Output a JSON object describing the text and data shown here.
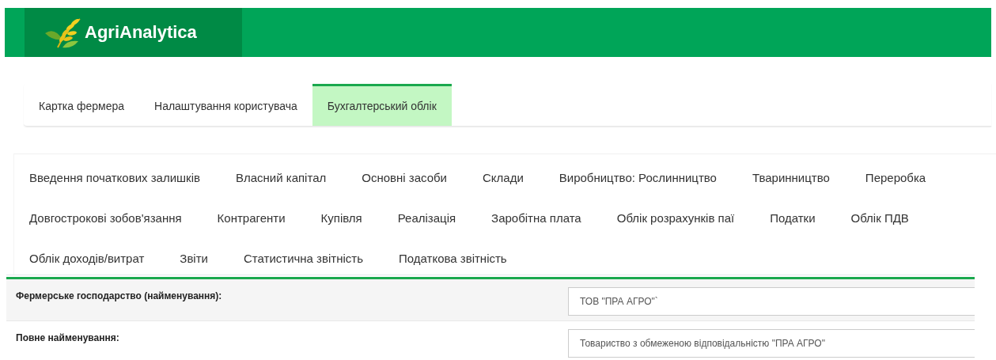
{
  "header": {
    "logo_text": "AgriAnalytica"
  },
  "tabs": [
    {
      "label": "Картка фермера",
      "selected": false
    },
    {
      "label": "Налаштування користувача",
      "selected": false
    },
    {
      "label": "Бухгалтерський облік",
      "selected": true
    }
  ],
  "submenu": {
    "items": [
      "Введення початкових залишків",
      "Власний капітал",
      "Основні засоби",
      "Склади",
      "Виробництво: Рослинництво",
      "Тваринництво",
      "Переробка",
      "Довгострокові зобов'язання",
      "Контрагенти",
      "Купівля",
      "Реалізація",
      "Заробітна плата",
      "Облік розрахунків паї",
      "Податки",
      "Облік ПДВ",
      "Облік доходів/витрат",
      "Звіти",
      "Статистична звітність",
      "Податкова звітність"
    ]
  },
  "form": {
    "rows": [
      {
        "label": "Фермерське господарство (найменування):",
        "value": "ТОВ \"ПРА АГРО\"`"
      },
      {
        "label": "Повне найменування:",
        "value": "Товариство з обмеженою відповідальністю \"ПРА АГРО\""
      }
    ]
  }
}
